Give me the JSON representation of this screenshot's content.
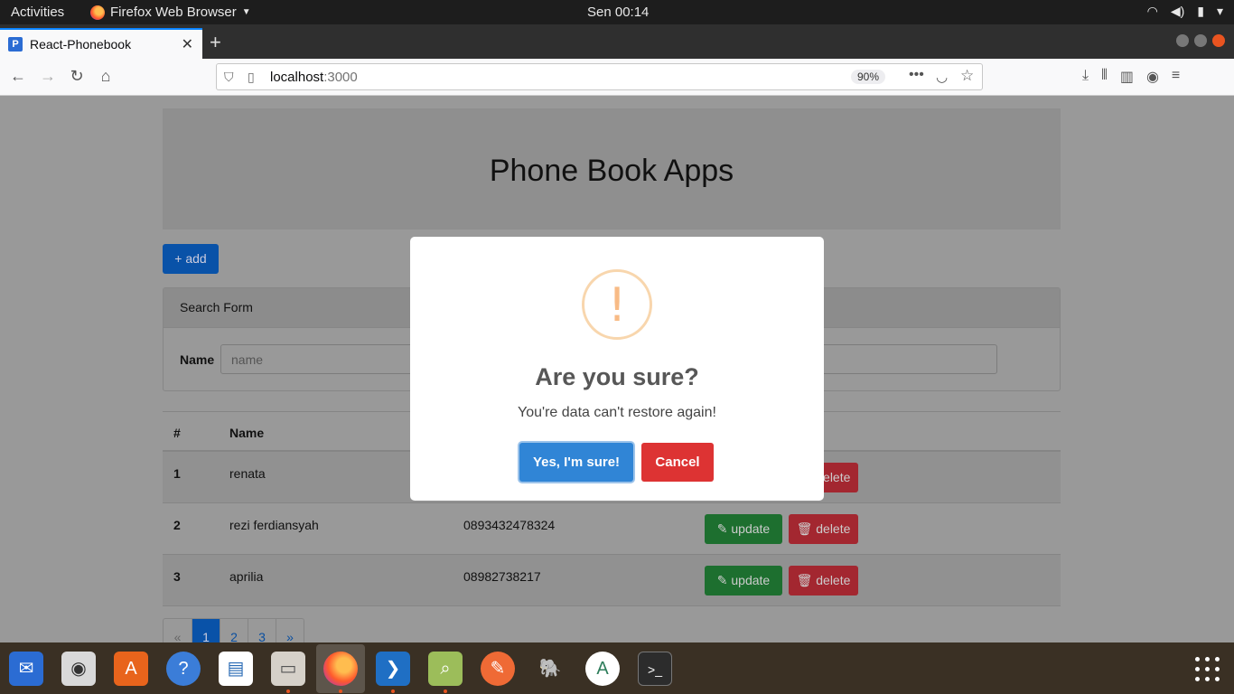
{
  "system": {
    "activities": "Activities",
    "app_menu": "Firefox Web Browser",
    "clock": "Sen 00:14"
  },
  "browser": {
    "tab_title": "React-Phonebook",
    "tab_favicon": "P",
    "url_host": "localhost",
    "url_port": ":3000",
    "zoom": "90%"
  },
  "app": {
    "title": "Phone Book Apps",
    "add_label": "+ add",
    "search": {
      "header": "Search Form",
      "name_label": "Name",
      "name_placeholder": "name"
    },
    "table": {
      "headers": [
        "#",
        "Name"
      ],
      "rows": [
        {
          "no": "1",
          "name": "renata",
          "phone": ""
        },
        {
          "no": "2",
          "name": "rezi ferdiansyah",
          "phone": "0893432478324"
        },
        {
          "no": "3",
          "name": "aprilia",
          "phone": "08982738217"
        }
      ],
      "update_label": "update",
      "delete_label": "delete"
    },
    "pagination": [
      "«",
      "1",
      "2",
      "3",
      "»"
    ],
    "active_page": "1"
  },
  "modal": {
    "icon": "!",
    "title": "Are you sure?",
    "text": "You're data can't restore again!",
    "confirm_label": "Yes, I'm sure!",
    "cancel_label": "Cancel"
  },
  "dock": {
    "apps": [
      "thunderbird-icon",
      "rhythmbox-icon",
      "software-center-icon",
      "help-icon",
      "libreoffice-writer-icon",
      "files-icon",
      "firefox-icon",
      "vscode-icon",
      "image-viewer-icon",
      "postman-icon",
      "pgadmin-icon",
      "android-studio-icon",
      "terminal-icon"
    ]
  },
  "colors": {
    "confirm": "#3085d6",
    "cancel": "#dd3333",
    "warning": "#f8bb86",
    "update": "#28a745",
    "delete": "#dc3545",
    "primary": "#0d6efd"
  }
}
